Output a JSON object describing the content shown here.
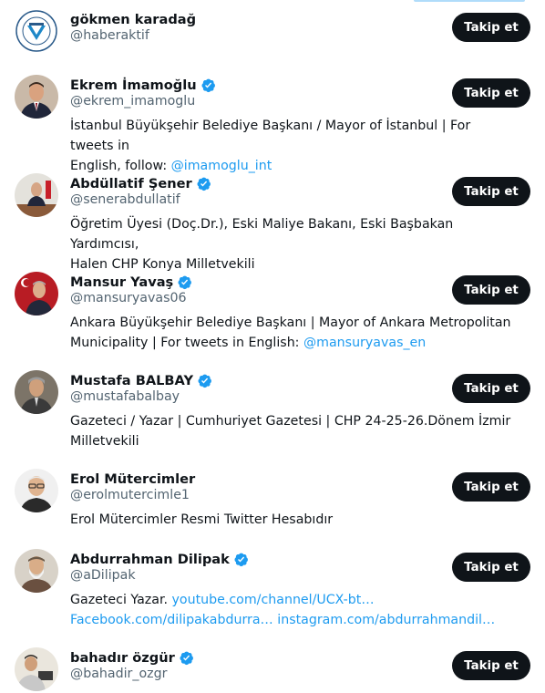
{
  "follow_label": "Takip et",
  "users": [
    {
      "name": "gökmen karadağ",
      "handle": "@haberaktif",
      "verified": false,
      "bio": []
    },
    {
      "name": "Ekrem İmamoğlu",
      "handle": "@ekrem_imamoglu",
      "verified": true,
      "bio": [
        [
          {
            "t": "İstanbul Büyükşehir Belediye Başkanı / Mayor of İstanbul | For tweets in"
          }
        ],
        [
          {
            "t": "English, follow: "
          },
          {
            "t": "@imamoglu_int",
            "link": true
          }
        ]
      ]
    },
    {
      "name": "Abdüllatif Şener",
      "handle": "@senerabdullatif",
      "verified": true,
      "bio": [
        [
          {
            "t": "Öğretim Üyesi (Doç.Dr.), Eski Maliye Bakanı, Eski Başbakan Yardımcısı,"
          }
        ],
        [
          {
            "t": "Halen CHP Konya Milletvekili"
          }
        ]
      ]
    },
    {
      "name": "Mansur Yavaş",
      "handle": "@mansuryavas06",
      "verified": true,
      "bio": [
        [
          {
            "t": "Ankara Büyükşehir Belediye Başkanı | Mayor of Ankara Metropolitan"
          }
        ],
        [
          {
            "t": "Municipality | For tweets in English: "
          },
          {
            "t": "@mansuryavas_en",
            "link": true
          }
        ]
      ]
    },
    {
      "name": "Mustafa BALBAY",
      "handle": "@mustafabalbay",
      "verified": true,
      "bio": [
        [
          {
            "t": "Gazeteci / Yazar | Cumhuriyet Gazetesi | CHP 24-25-26.Dönem İzmir"
          }
        ],
        [
          {
            "t": "Milletvekili"
          }
        ]
      ]
    },
    {
      "name": "Erol Mütercimler",
      "handle": "@erolmutercimle1",
      "verified": false,
      "bio": [
        [
          {
            "t": "Erol Mütercimler Resmi Twitter Hesabıdır"
          }
        ]
      ]
    },
    {
      "name": "Abdurrahman Dilipak",
      "handle": "@aDilipak",
      "verified": true,
      "bio": [
        [
          {
            "t": "Gazeteci Yazar. "
          },
          {
            "t": "youtube.com/channel/UCX-bt…",
            "link": true
          }
        ],
        [
          {
            "t": "Facebook.com/dilipakabdurra…",
            "link": true
          },
          {
            "t": " "
          },
          {
            "t": "instagram.com/abdurrahmandil…",
            "link": true
          }
        ]
      ]
    },
    {
      "name": "bahadır özgür",
      "handle": "@bahadir_ozgr",
      "verified": true,
      "bio": []
    }
  ],
  "colors": {
    "accent": "#1d9bf0",
    "text": "#0f1419",
    "muted": "#536471",
    "button": "#0f1419"
  },
  "icons": {
    "verified": "verified-badge-icon"
  }
}
